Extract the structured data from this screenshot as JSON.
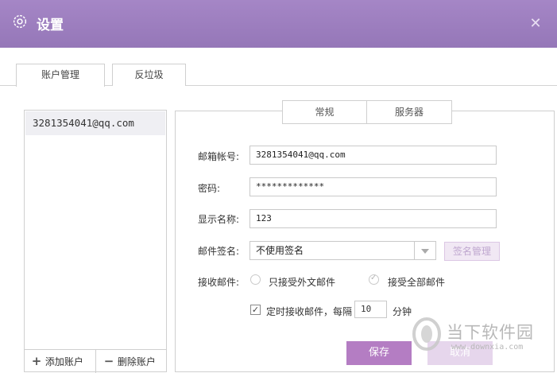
{
  "window": {
    "title": "设置",
    "close_label": "✕"
  },
  "top_tabs": [
    {
      "label": "账户管理"
    },
    {
      "label": "反垃圾"
    }
  ],
  "accounts": [
    {
      "email": "3281354041@qq.com"
    }
  ],
  "account_buttons": {
    "add_label": "添加账户",
    "delete_label": "删除账户"
  },
  "sub_tabs": [
    {
      "label": "常规"
    },
    {
      "label": "服务器"
    }
  ],
  "form": {
    "email": {
      "label": "邮箱帐号:",
      "value": "3281354041@qq.com"
    },
    "password": {
      "label": "密码:",
      "value": "*************"
    },
    "display_name": {
      "label": "显示名称:",
      "value": "123"
    },
    "signature": {
      "label": "邮件签名:",
      "value": "不使用签名",
      "manage_label": "签名管理"
    },
    "receive": {
      "label": "接收邮件:",
      "option_external": "只接受外文邮件",
      "option_all": "接受全部邮件"
    },
    "schedule": {
      "label": "定时接收邮件，每隔",
      "interval": "10",
      "unit": "分钟"
    }
  },
  "actions": {
    "save_label": "保存",
    "cancel_label": "取消"
  },
  "watermark": {
    "name": "当下软件园",
    "url": "www.downxia.com"
  },
  "colors": {
    "titlebar": "#9b7dbd",
    "accent": "#b47dc3"
  }
}
